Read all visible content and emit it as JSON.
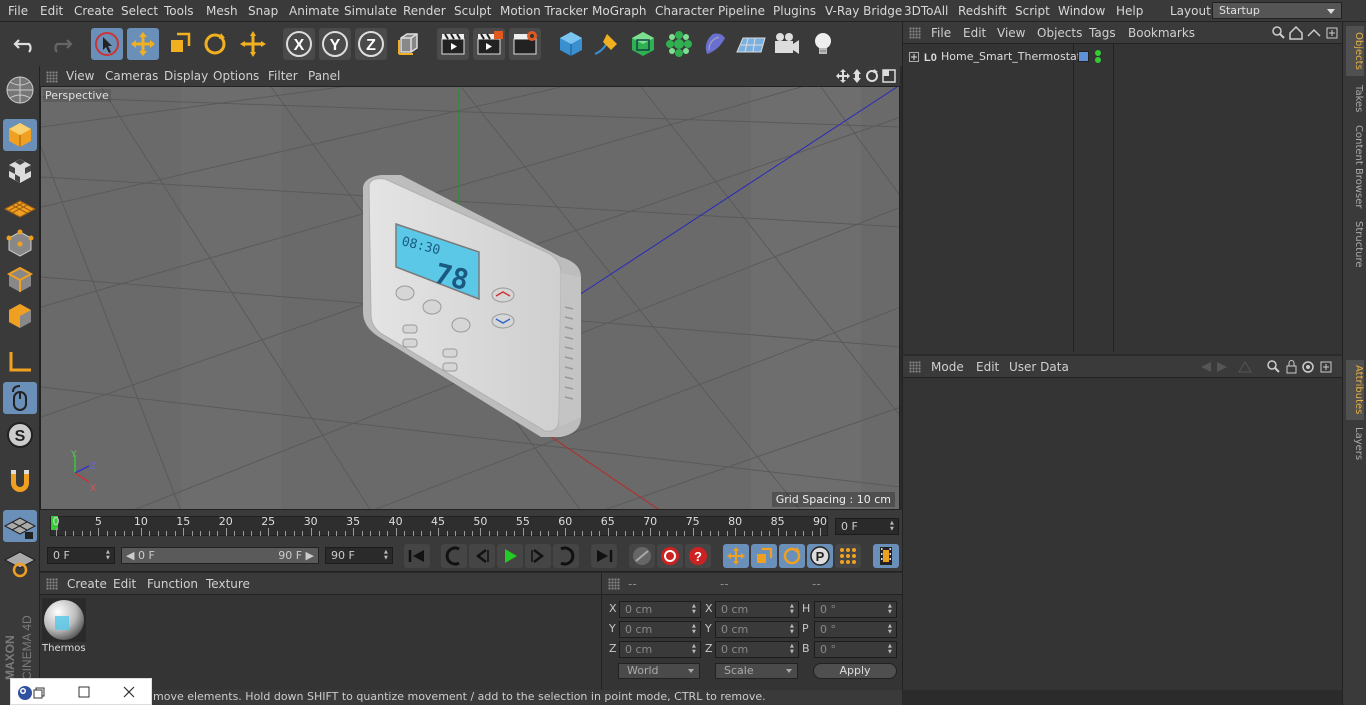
{
  "menubar": {
    "items": [
      "File",
      "Edit",
      "Create",
      "Select",
      "Tools",
      "Mesh",
      "Snap",
      "Animate",
      "Simulate",
      "Render",
      "Sculpt",
      "Motion Tracker",
      "MoGraph",
      "Character",
      "Pipeline",
      "Plugins",
      "V-Ray Bridge",
      "3DToAll",
      "Redshift",
      "Script",
      "Window",
      "Help"
    ],
    "layout_label": "Layout:",
    "layout_value": "Startup"
  },
  "viewport": {
    "menu": [
      "View",
      "Cameras",
      "Display",
      "Options",
      "Filter",
      "Panel"
    ],
    "label": "Perspective",
    "grid_spacing": "Grid Spacing : 10 cm",
    "lcd_time": "08:30",
    "lcd_temp": "78",
    "axis_y": "Y",
    "axis_z": "Z",
    "axis_x": "X"
  },
  "timeline": {
    "ticks": [
      "0",
      "5",
      "10",
      "15",
      "20",
      "25",
      "30",
      "35",
      "40",
      "45",
      "50",
      "55",
      "60",
      "65",
      "70",
      "75",
      "80",
      "85",
      "90"
    ],
    "current_frame_field": "0 F"
  },
  "controls": {
    "start_field": "0 F",
    "range_start": "0 F",
    "range_end": "90 F",
    "end_field": "90 F"
  },
  "material_panel": {
    "menu": [
      "Create",
      "Edit",
      "Function",
      "Texture"
    ],
    "material_name": "Thermos"
  },
  "coord_panel": {
    "headers": [
      "--",
      "--",
      "--"
    ],
    "rows": [
      {
        "a": "X",
        "av": "0 cm",
        "b": "X",
        "bv": "0 cm",
        "c": "H",
        "cv": "0 °"
      },
      {
        "a": "Y",
        "av": "0 cm",
        "b": "Y",
        "bv": "0 cm",
        "c": "P",
        "cv": "0 °"
      },
      {
        "a": "Z",
        "av": "0 cm",
        "b": "Z",
        "bv": "0 cm",
        "c": "B",
        "cv": "0 °"
      }
    ],
    "mode_dropdown": "World",
    "scale_dropdown": "Scale",
    "apply_label": "Apply"
  },
  "object_manager": {
    "menu": [
      "File",
      "Edit",
      "View",
      "Objects",
      "Tags",
      "Bookmarks"
    ],
    "object_name": "Home_Smart_Thermostat"
  },
  "attribute_manager": {
    "menu": [
      "Mode",
      "Edit",
      "User Data"
    ]
  },
  "right_tabs": [
    "Objects",
    "Takes",
    "Content Browser",
    "Structure",
    "Attributes",
    "Layers"
  ],
  "status": {
    "text": "move elements. Hold down SHIFT to quantize movement / add to the selection in point mode, CTRL to remove."
  },
  "brand": {
    "line1": "MAXON",
    "line2": "CINEMA 4D"
  },
  "colors": {
    "accent": "#6a8fb8",
    "panel": "#343434",
    "header": "#3a3a3a",
    "viewport": "#6d6d6d",
    "lcd": "#5cc8e8"
  }
}
